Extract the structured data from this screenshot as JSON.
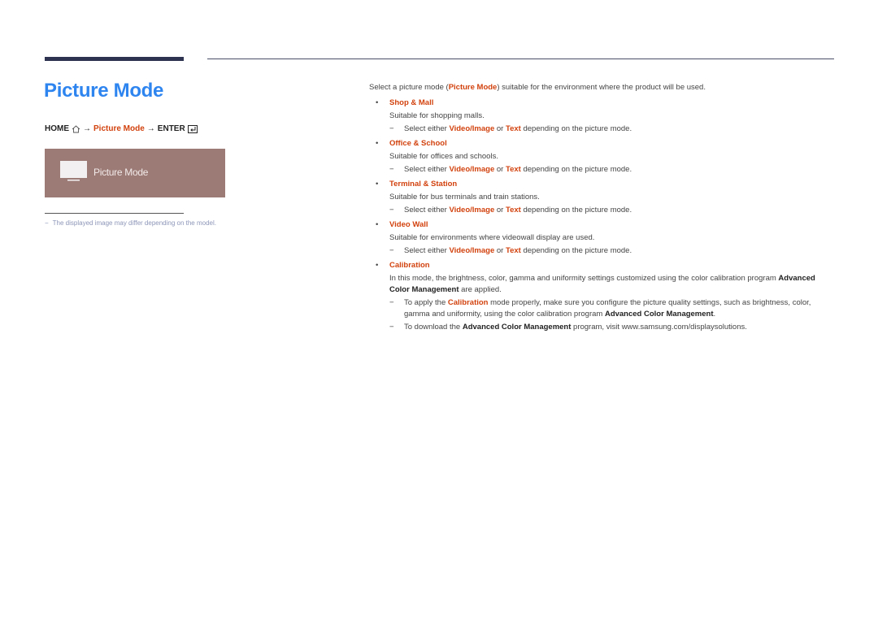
{
  "page": {
    "title": "Picture Mode",
    "nav_path": {
      "home": "HOME",
      "home_icon": "home-icon",
      "arrow": "→",
      "item": "Picture Mode",
      "enter": "ENTER",
      "enter_icon": "enter-icon"
    },
    "preview": {
      "icon": "tv-icon",
      "label": "Picture Mode"
    },
    "note": {
      "dash": "−",
      "text": "The displayed image may differ depending on the model."
    }
  },
  "content": {
    "intro": {
      "before": "Select a picture mode (",
      "highlight": "Picture Mode",
      "after": ") suitable for the environment where the product will be used."
    },
    "bullet": "•",
    "dash": "−",
    "subnote_common": {
      "before": "Select either ",
      "opt1": "Video/Image",
      "mid": " or ",
      "opt2": "Text",
      "after": " depending on the picture mode."
    },
    "modes": [
      {
        "name": "Shop & Mall",
        "desc": "Suitable for shopping malls."
      },
      {
        "name": "Office & School",
        "desc": "Suitable for offices and schools."
      },
      {
        "name": "Terminal & Station",
        "desc": "Suitable for bus terminals and train stations."
      },
      {
        "name": "Video Wall",
        "desc": "Suitable for environments where videowall display are used."
      }
    ],
    "calibration": {
      "name": "Calibration",
      "desc_before": "In this mode, the brightness, color, gamma and uniformity settings customized using the color calibration program ",
      "desc_bold": "Advanced Color Management",
      "desc_after": " are applied.",
      "note1": {
        "before": "To apply the ",
        "red": "Calibration",
        "mid": " mode properly, make sure you configure the picture quality settings, such as brightness, color, gamma and uniformity, using the color calibration program ",
        "bold": "Advanced Color Management",
        "after": "."
      },
      "note2": {
        "before": "To download the ",
        "bold": "Advanced Color Management",
        "after": " program, visit www.samsung.com/displaysolutions."
      }
    }
  },
  "colors": {
    "title_blue": "#2f85f0",
    "accent_red": "#d2420e",
    "rule_navy": "#2e3350",
    "preview_bg": "#9c7b76"
  }
}
